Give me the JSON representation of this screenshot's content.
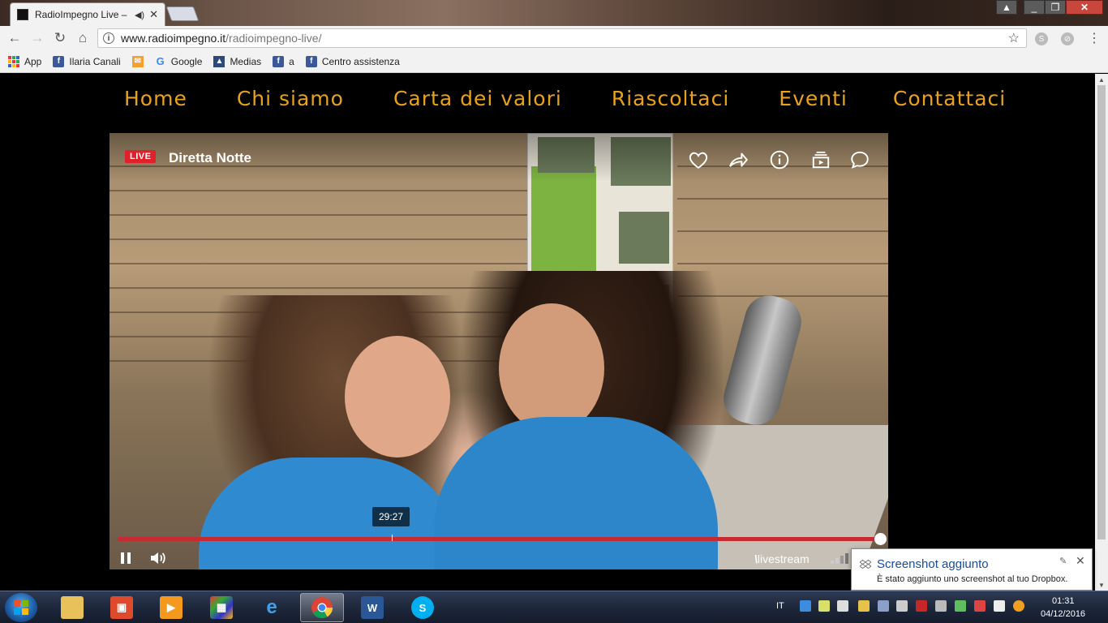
{
  "browser": {
    "tab_title": "RadioImpegno Live –",
    "url_host": "www.radioimpegno.it",
    "url_path": "/radioimpegno-live/",
    "bookmarks": [
      "App",
      "Ilaria Canali",
      "Google",
      "Medias",
      "a",
      "Centro assistenza"
    ]
  },
  "site": {
    "nav": [
      "Home",
      "Chi siamo",
      "Carta dei valori",
      "Riascoltaci",
      "Eventi",
      "Contattaci"
    ],
    "nav_color": "#e8a21a"
  },
  "player": {
    "live_badge": "LIVE",
    "title": "Diretta Notte",
    "tooltip_time": "29:27",
    "brand": "livestream",
    "progress": 1.0,
    "icons": [
      "heart-icon",
      "share-icon",
      "info-icon",
      "playlist-icon",
      "chat-icon",
      "pause-icon",
      "volume-icon"
    ]
  },
  "notification": {
    "title": "Screenshot aggiunto",
    "body": "È stato aggiunto uno screenshot al tuo Dropbox."
  },
  "taskbar": {
    "language": "IT",
    "time": "01:31",
    "date": "04/12/2016"
  }
}
